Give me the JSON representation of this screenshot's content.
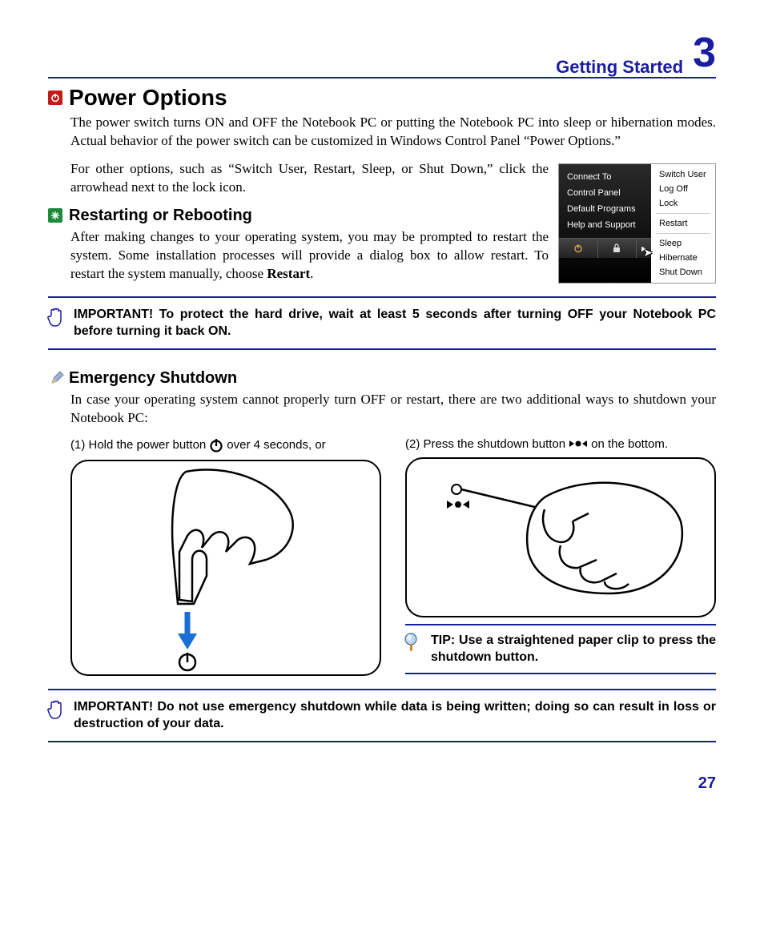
{
  "header": {
    "title": "Getting Started",
    "chapter": "3"
  },
  "sections": {
    "power_options": {
      "title": "Power Options",
      "p1": "The power switch turns ON and OFF the Notebook PC or putting the Notebook PC into sleep or hibernation modes. Actual behavior of the power switch can be customized in Windows Control Panel “Power Options.”",
      "p2": "For other options, such as “Switch User, Restart, Sleep, or Shut Down,” click the arrowhead next to the lock icon."
    },
    "restarting": {
      "title": "Restarting or Rebooting",
      "p1_pre": "After making changes to your operating system, you may be prompted to restart the system. Some installation processes will provide a dialog box to allow restart. To restart the system manually, choose ",
      "p1_bold": "Restart",
      "p1_post": "."
    },
    "emergency": {
      "title": "Emergency Shutdown",
      "p1": "In case your operating system cannot properly turn OFF or restart, there are two additional ways to shutdown your Notebook PC:",
      "step1_pre": "(1) Hold the power button ",
      "step1_post": " over 4 seconds, or",
      "step2_pre": "(2) Press the shutdown button ",
      "step2_post": " on the bottom."
    }
  },
  "start_menu": {
    "left": [
      "Connect To",
      "Control Panel",
      "Default Programs",
      "Help and Support"
    ],
    "right_top": [
      "Switch User",
      "Log Off",
      "Lock"
    ],
    "right_bottom": [
      "Restart",
      "Sleep",
      "Hibernate",
      "Shut Down"
    ]
  },
  "callouts": {
    "important1": "IMPORTANT!  To protect the hard drive, wait at least 5 seconds after turning OFF your Notebook PC before turning it back ON.",
    "tip": "TIP: Use a straightened paper clip to press the shutdown button.",
    "important2": "IMPORTANT!  Do not use emergency shutdown while data is being written; doing so can result in loss or destruction of your data."
  },
  "page_number": "27"
}
